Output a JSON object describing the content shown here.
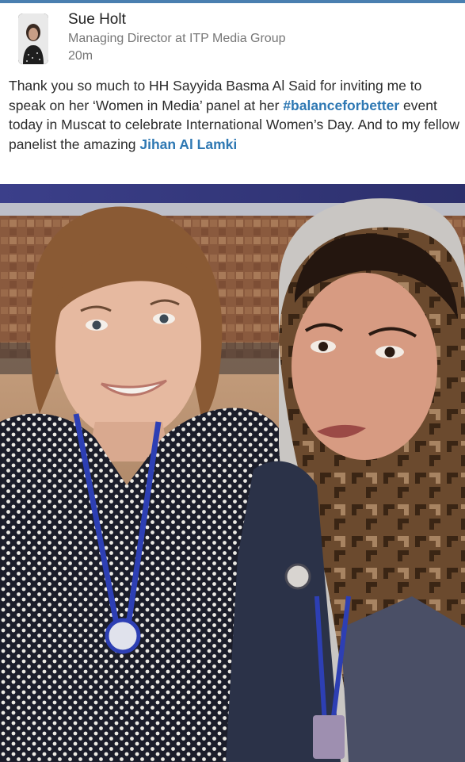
{
  "post": {
    "author": {
      "name": "Sue Holt",
      "headline": "Managing Director at ITP Media Group",
      "time": "20m"
    },
    "text": {
      "part1": "Thank you so much to HH Sayyida Basma Al Said for inviting me to speak on her ‘Women in Media’ panel at her ",
      "hashtag": "#balanceforbetter",
      "part2": " event today in Muscat to celebrate International Women’s Day. And to my fellow panelist the amazing ",
      "mention": "Jihan Al Lamki"
    },
    "image": {
      "type": "photo",
      "subject": "selfie-two-women"
    }
  },
  "colors": {
    "accent_bar": "#4a7fb0",
    "link": "#2e78b3",
    "text": "#2b2b2b",
    "meta": "#777777"
  }
}
